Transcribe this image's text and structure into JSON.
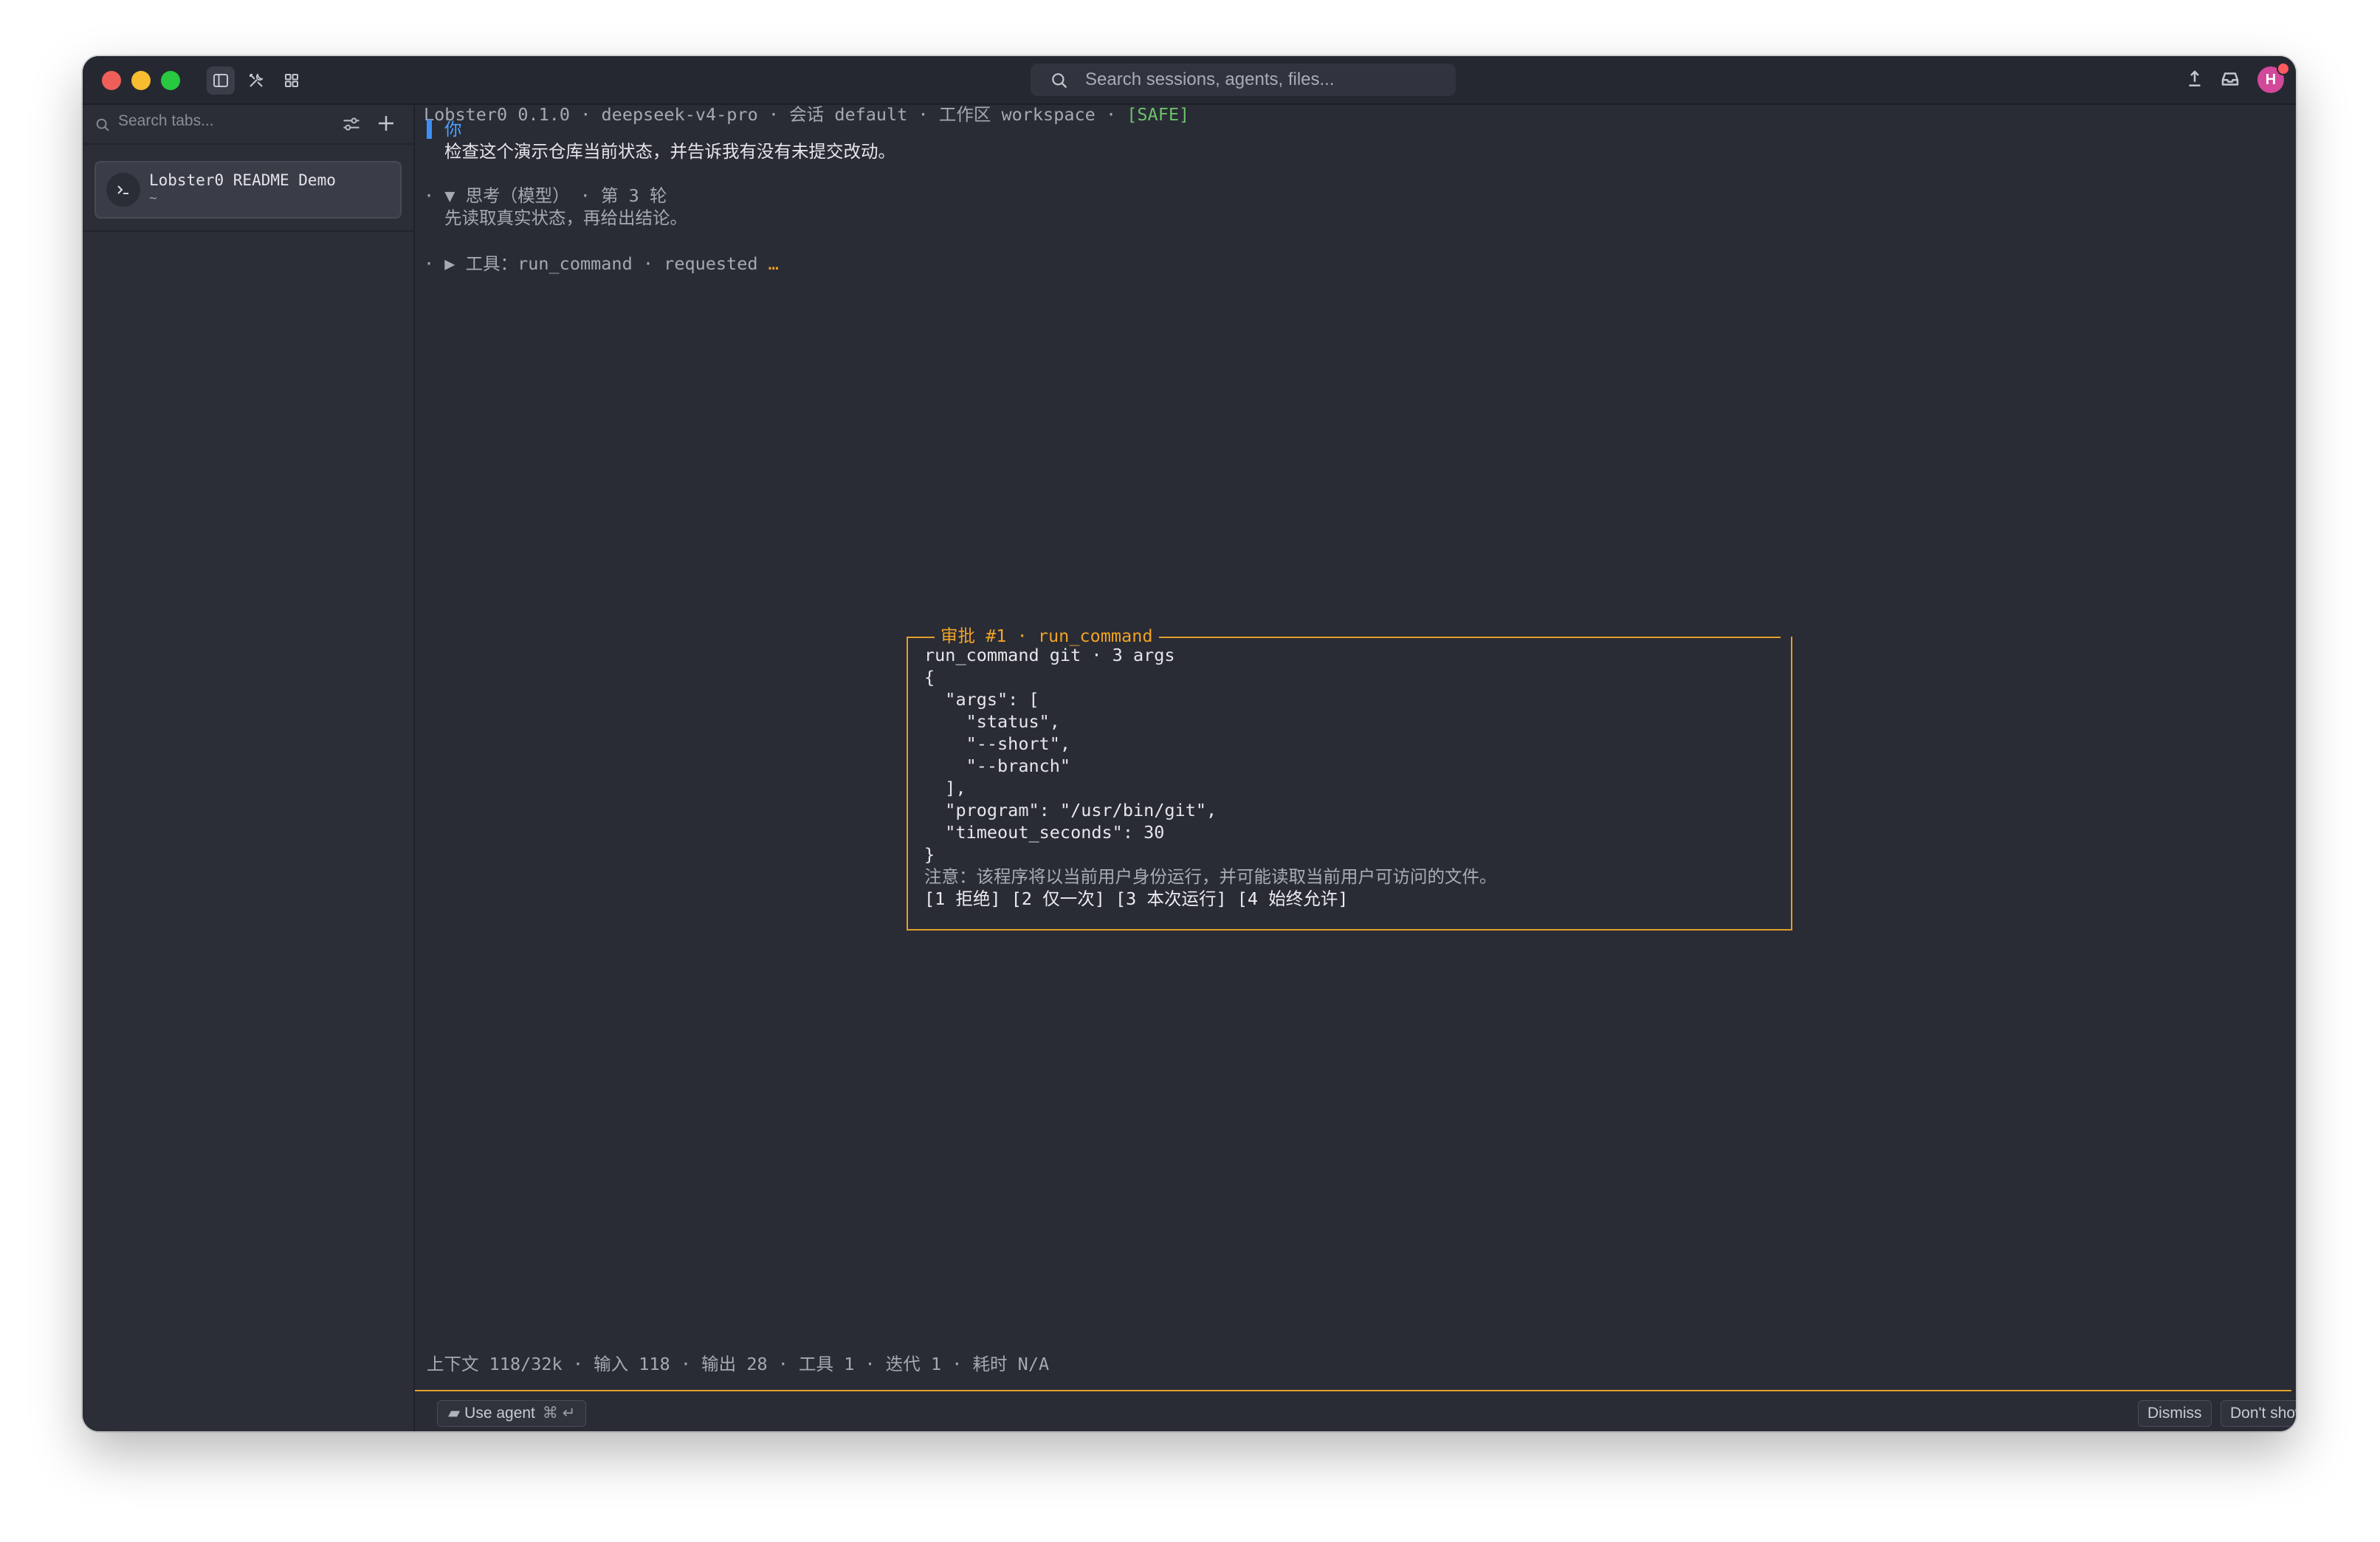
{
  "window": {
    "toolbar": {
      "sidebar_toggle_icon": "sidebar-icon",
      "tools_icon": "tools-icon",
      "grid_icon": "grid-icon"
    },
    "search": {
      "placeholder": "Search sessions, agents, files...",
      "icon": "search-icon"
    },
    "right_icons": [
      "download-icon",
      "inbox-icon"
    ],
    "avatar": {
      "initial": "H",
      "color": "#d2489a"
    }
  },
  "sidebar": {
    "search_placeholder": "Search tabs...",
    "tabs": [
      {
        "title": "Lobster0 README Demo",
        "subtitle": "~",
        "icon": "terminal-icon"
      }
    ]
  },
  "terminal": {
    "header": {
      "text": "Lobster0 0.1.0 · deepseek-v4-pro · 会话 default · 工作区 workspace · ",
      "mode": "[SAFE]"
    },
    "user_label": "你",
    "user_message": "检查这个演示仓库当前状态，并告诉我有没有未提交改动。",
    "thinking": {
      "label": "· ▼ 思考（模型） · 第 3 轮",
      "text": "先读取真实状态，再给出结论。"
    },
    "tool_line": {
      "text": "· ▶ 工具：run_command · requested ",
      "suffix": "…"
    },
    "approval": {
      "title": "审批 #1 · run_command",
      "summary": "run_command git · 3 args",
      "json_lines": [
        "{",
        "  \"args\": [",
        "    \"status\",",
        "    \"--short\",",
        "    \"--branch\"",
        "  ],",
        "  \"program\": \"/usr/bin/git\",",
        "  \"timeout_seconds\": 30",
        "}"
      ],
      "note": "注意：该程序将以当前用户身份运行，并可能读取当前用户可访问的文件。",
      "options": [
        "[1 拒绝]",
        "[2 仅一次]",
        "[3 本次运行]",
        "[4 始终允许]"
      ]
    },
    "status_line": "上下文 118/32k · 输入 118 · 输出 28 · 工具 1 · 迭代 1 · 耗时 N/A",
    "accent_color": "#e0a028"
  },
  "footer": {
    "use_agent": "Use agent",
    "shortcut": "⌘ ↵",
    "dismiss": "Dismiss",
    "dont_show": "Don't show again"
  }
}
